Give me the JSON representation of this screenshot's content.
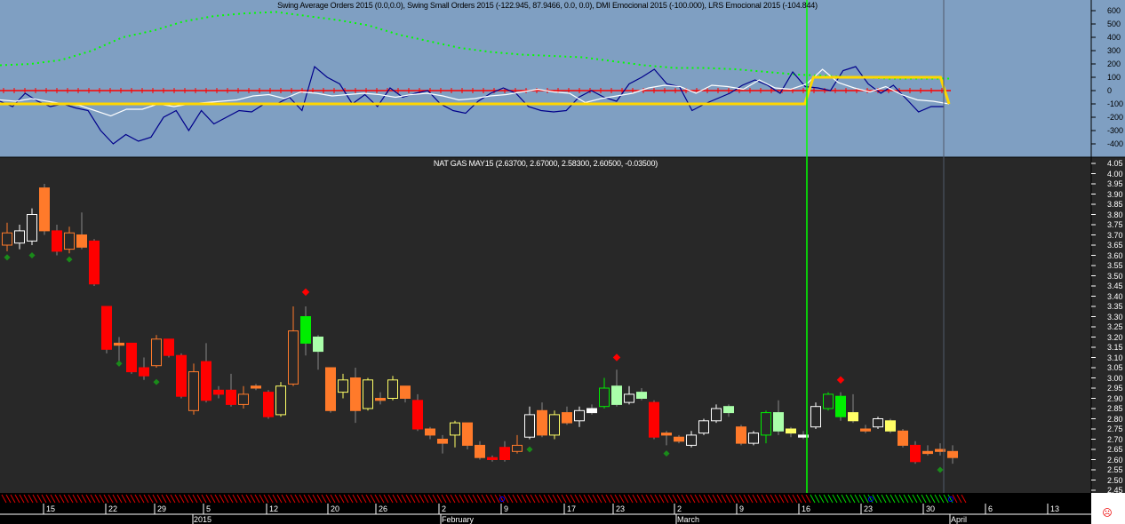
{
  "indicator_panel": {
    "title": "Swing Average Orders 2015 (0.0,0.0), Swing Small Orders 2015 (-122.945, 87.9466, 0.0, 0.0), DMI Emocional 2015 (-100.000), LRS Emocional 2015 (-104.844)",
    "y_ticks": [
      "600",
      "500",
      "400",
      "300",
      "200",
      "100",
      "0",
      "-100",
      "-200",
      "-300",
      "-400"
    ],
    "y_range": [
      -450,
      650
    ],
    "blue": [
      -80,
      -120,
      -20,
      -80,
      -120,
      -100,
      -130,
      -150,
      -300,
      -400,
      -330,
      -380,
      -350,
      -200,
      -150,
      -300,
      -150,
      -250,
      -200,
      -150,
      -160,
      -100,
      -100,
      -50,
      -150,
      180,
      100,
      50,
      -100,
      -30,
      -120,
      20,
      -50,
      -20,
      0,
      -100,
      -150,
      -170,
      -80,
      -20,
      20,
      -20,
      -120,
      -150,
      -160,
      -150,
      -50,
      0,
      -50,
      -80,
      50,
      100,
      160,
      50,
      30,
      -150,
      -100,
      -60,
      -20,
      40,
      80,
      40,
      -20,
      140,
      30,
      20,
      0,
      150,
      180,
      50,
      -20,
      40,
      -60,
      -160,
      -120,
      -120
    ],
    "white": [
      -70,
      -80,
      -60,
      -80,
      -100,
      -110,
      -150,
      -190,
      -140,
      -140,
      -100,
      -120,
      -100,
      -90,
      -80,
      -70,
      -40,
      -30,
      -60,
      -10,
      -20,
      -40,
      -30,
      -20,
      -30,
      -50,
      -30,
      -20,
      -40,
      -70,
      -60,
      -40,
      -30,
      -10,
      10,
      -10,
      -20,
      -90,
      -60,
      -40,
      -20,
      20,
      40,
      30,
      -20,
      40,
      30,
      10,
      80,
      20,
      10,
      50,
      160,
      60,
      20,
      -10,
      30,
      -30,
      -70,
      -80,
      -100
    ],
    "green": [
      190,
      200,
      230,
      300,
      400,
      450,
      520,
      560,
      580,
      590,
      560,
      530,
      490,
      420,
      370,
      320,
      290,
      270,
      260,
      250,
      220,
      190,
      170,
      170,
      160,
      140,
      120,
      110,
      100,
      90,
      90,
      90
    ],
    "yellow": [
      [
        0,
        -100
      ],
      [
        0.848,
        -100
      ],
      [
        0.857,
        100
      ],
      [
        0.991,
        100
      ],
      [
        1.0,
        -100
      ]
    ]
  },
  "price_panel": {
    "title": "NAT GAS MAY15 (2.63700, 2.67000, 2.58300, 2.60500, -0.03500)",
    "y_range": [
      2.45,
      4.05
    ],
    "y_ticks": [
      "4.05",
      "4.00",
      "3.95",
      "3.90",
      "3.85",
      "3.80",
      "3.75",
      "3.70",
      "3.65",
      "3.60",
      "3.55",
      "3.50",
      "3.45",
      "3.40",
      "3.35",
      "3.30",
      "3.25",
      "3.20",
      "3.15",
      "3.10",
      "3.05",
      "3.00",
      "2.95",
      "2.90",
      "2.85",
      "2.80",
      "2.75",
      "2.70",
      "2.65",
      "2.60",
      "2.55",
      "2.50",
      "2.45"
    ],
    "candles": [
      [
        3.65,
        3.71,
        3.76,
        3.62,
        "#ff7a2a"
      ],
      [
        3.66,
        3.72,
        3.75,
        3.63,
        "#ffffff"
      ],
      [
        3.67,
        3.8,
        3.83,
        3.65,
        "#ffffff"
      ],
      [
        3.93,
        3.72,
        3.95,
        3.7,
        "#ff7a2a"
      ],
      [
        3.72,
        3.62,
        3.75,
        3.6,
        "#ff0000"
      ],
      [
        3.63,
        3.71,
        3.74,
        3.61,
        "#ff7a2a"
      ],
      [
        3.7,
        3.64,
        3.81,
        3.63,
        "#ff7a2a"
      ],
      [
        3.67,
        3.46,
        3.68,
        3.45,
        "#ff0000"
      ],
      [
        3.35,
        3.14,
        3.35,
        3.12,
        "#ff0000"
      ],
      [
        3.17,
        3.16,
        3.2,
        3.08,
        "#ff7a2a"
      ],
      [
        3.17,
        3.03,
        3.17,
        3.02,
        "#ff0000"
      ],
      [
        3.05,
        3.01,
        3.1,
        2.99,
        "#ff0000"
      ],
      [
        3.06,
        3.19,
        3.21,
        3.05,
        "#ff7a2a"
      ],
      [
        3.19,
        3.11,
        3.19,
        3.1,
        "#ff0000"
      ],
      [
        3.11,
        2.91,
        3.12,
        2.9,
        "#ff0000"
      ],
      [
        2.84,
        3.03,
        3.07,
        2.82,
        "#ff7a2a"
      ],
      [
        3.08,
        2.89,
        3.17,
        2.88,
        "#ff0000"
      ],
      [
        2.94,
        2.92,
        2.96,
        2.9,
        "#ff0000"
      ],
      [
        2.94,
        2.87,
        3.02,
        2.86,
        "#ff0000"
      ],
      [
        2.87,
        2.92,
        2.96,
        2.85,
        "#ff7a2a"
      ],
      [
        2.96,
        2.95,
        2.97,
        2.94,
        "#ff7a2a"
      ],
      [
        2.93,
        2.81,
        2.94,
        2.8,
        "#ff0000"
      ],
      [
        2.82,
        2.96,
        2.98,
        2.81,
        "#ffff66"
      ],
      [
        2.97,
        3.23,
        3.35,
        2.96,
        "#ff7a2a"
      ],
      [
        3.3,
        3.17,
        3.35,
        3.11,
        "#00ee00"
      ],
      [
        3.2,
        3.13,
        3.21,
        3.04,
        "#aaffaa"
      ],
      [
        3.05,
        2.84,
        3.05,
        2.83,
        "#ff7a2a"
      ],
      [
        2.93,
        2.99,
        3.02,
        2.9,
        "#ffff66"
      ],
      [
        3.0,
        2.84,
        3.05,
        2.78,
        "#ff7a2a"
      ],
      [
        2.85,
        2.99,
        3.0,
        2.84,
        "#ffff66"
      ],
      [
        2.9,
        2.89,
        2.93,
        2.87,
        "#ff7a2a"
      ],
      [
        2.9,
        2.99,
        3.01,
        2.89,
        "#ffff66"
      ],
      [
        2.96,
        2.9,
        2.96,
        2.88,
        "#ff7a2a"
      ],
      [
        2.89,
        2.75,
        2.92,
        2.74,
        "#ff0000"
      ],
      [
        2.75,
        2.72,
        2.76,
        2.7,
        "#ff7a2a"
      ],
      [
        2.7,
        2.68,
        2.72,
        2.63,
        "#ff7a2a"
      ],
      [
        2.72,
        2.78,
        2.79,
        2.66,
        "#ffff66"
      ],
      [
        2.78,
        2.67,
        2.78,
        2.65,
        "#ff7a2a"
      ],
      [
        2.67,
        2.61,
        2.69,
        2.6,
        "#ff7a2a"
      ],
      [
        2.61,
        2.6,
        2.62,
        2.59,
        "#ff0000"
      ],
      [
        2.66,
        2.6,
        2.69,
        2.59,
        "#ff0000"
      ],
      [
        2.64,
        2.67,
        2.72,
        2.63,
        "#ff7a2a"
      ],
      [
        2.71,
        2.82,
        2.86,
        2.7,
        "#ffffff"
      ],
      [
        2.84,
        2.72,
        2.88,
        2.71,
        "#ff7a2a"
      ],
      [
        2.72,
        2.82,
        2.84,
        2.7,
        "#ffff66"
      ],
      [
        2.83,
        2.78,
        2.86,
        2.77,
        "#ff7a2a"
      ],
      [
        2.79,
        2.84,
        2.86,
        2.76,
        "#ffffff"
      ],
      [
        2.85,
        2.83,
        2.87,
        2.82,
        "#ffffff"
      ],
      [
        2.86,
        2.95,
        3.0,
        2.85,
        "#00ee00"
      ],
      [
        2.96,
        2.87,
        3.04,
        2.86,
        "#aaffaa"
      ],
      [
        2.88,
        2.92,
        2.96,
        2.87,
        "#ffffff"
      ],
      [
        2.93,
        2.9,
        2.95,
        2.89,
        "#aaffaa"
      ],
      [
        2.88,
        2.71,
        2.89,
        2.7,
        "#ff0000"
      ],
      [
        2.73,
        2.72,
        2.74,
        2.67,
        "#ff7a2a"
      ],
      [
        2.71,
        2.69,
        2.72,
        2.68,
        "#ff7a2a"
      ],
      [
        2.67,
        2.72,
        2.74,
        2.66,
        "#ffffff"
      ],
      [
        2.73,
        2.79,
        2.8,
        2.72,
        "#ffffff"
      ],
      [
        2.79,
        2.85,
        2.87,
        2.78,
        "#ffffff"
      ],
      [
        2.86,
        2.83,
        2.87,
        2.81,
        "#aaffaa"
      ],
      [
        2.76,
        2.68,
        2.77,
        2.67,
        "#ff7a2a"
      ],
      [
        2.68,
        2.73,
        2.74,
        2.67,
        "#ffffff"
      ],
      [
        2.72,
        2.83,
        2.84,
        2.68,
        "#00ee00"
      ],
      [
        2.83,
        2.74,
        2.89,
        2.72,
        "#aaffaa"
      ],
      [
        2.75,
        2.73,
        2.76,
        2.71,
        "#ffff66"
      ],
      [
        2.72,
        2.71,
        2.74,
        2.7,
        "#ffffff"
      ],
      [
        2.76,
        2.86,
        2.88,
        2.75,
        "#ffffff"
      ],
      [
        2.85,
        2.92,
        2.93,
        2.84,
        "#00ee00"
      ],
      [
        2.91,
        2.81,
        2.93,
        2.79,
        "#00ee00"
      ],
      [
        2.83,
        2.79,
        2.92,
        2.78,
        "#ffff66"
      ],
      [
        2.75,
        2.74,
        2.77,
        2.73,
        "#ff7a2a"
      ],
      [
        2.76,
        2.8,
        2.81,
        2.75,
        "#ffffff"
      ],
      [
        2.79,
        2.74,
        2.8,
        2.73,
        "#ffff66"
      ],
      [
        2.74,
        2.67,
        2.75,
        2.66,
        "#ff7a2a"
      ],
      [
        2.67,
        2.59,
        2.69,
        2.58,
        "#ff0000"
      ],
      [
        2.64,
        2.63,
        2.67,
        2.62,
        "#ff7a2a"
      ],
      [
        2.65,
        2.64,
        2.68,
        2.62,
        "#ff7a2a"
      ],
      [
        2.64,
        2.61,
        2.67,
        2.58,
        "#ff7a2a"
      ]
    ],
    "green_markers": [
      [
        0,
        3.59
      ],
      [
        2,
        3.6
      ],
      [
        5,
        3.58
      ],
      [
        9,
        3.07
      ],
      [
        12,
        2.98
      ],
      [
        42,
        2.65
      ],
      [
        53,
        2.63
      ],
      [
        75,
        2.55
      ]
    ],
    "red_markers": [
      [
        24,
        3.42
      ],
      [
        49,
        3.1
      ],
      [
        67,
        2.99
      ]
    ]
  },
  "x_axis": {
    "day_labels": [
      [
        "15",
        52
      ],
      [
        "22",
        122
      ],
      [
        "29",
        177
      ],
      [
        "5",
        232
      ],
      [
        "12",
        303
      ],
      [
        "20",
        372
      ],
      [
        "26",
        426
      ],
      [
        "2",
        497
      ],
      [
        "9",
        567
      ],
      [
        "17",
        638
      ],
      [
        "23",
        693
      ],
      [
        "2",
        762
      ],
      [
        "9",
        832
      ],
      [
        "16",
        902
      ],
      [
        "23",
        972
      ],
      [
        "30",
        1042
      ],
      [
        "6",
        1112
      ],
      [
        "13",
        1182
      ]
    ],
    "month_labels": [
      [
        "2015",
        218
      ],
      [
        "February",
        497
      ],
      [
        "March",
        762
      ],
      [
        "April",
        1070
      ]
    ]
  },
  "colors": {
    "indicator_bg": "#7f9fc2",
    "price_bg": "#282828",
    "blue": "#00008b",
    "yellow": "#ffd700",
    "green_dots": "#00ff00",
    "cursor": "#00ff00"
  },
  "icons": {
    "close": "close-circle-icon"
  }
}
